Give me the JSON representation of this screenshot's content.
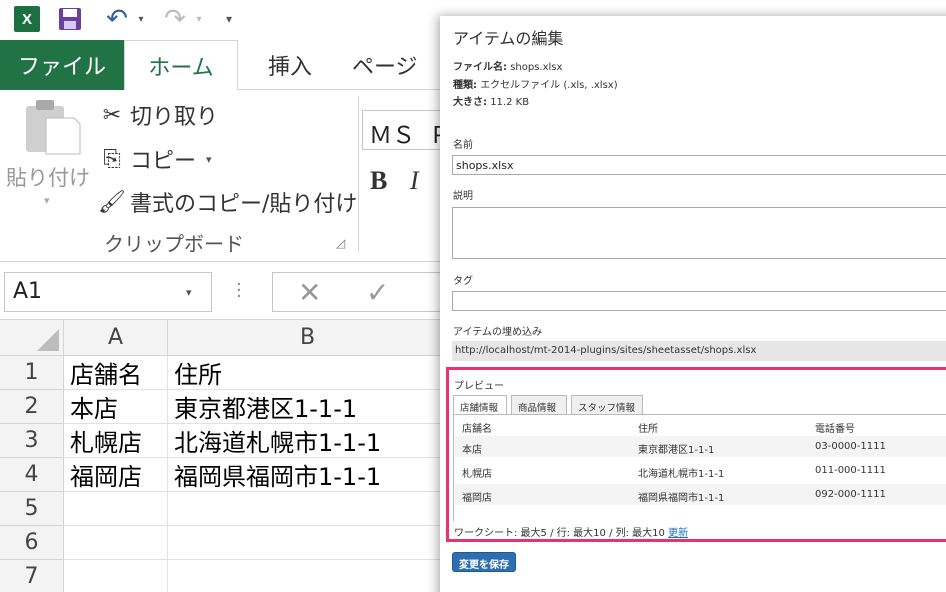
{
  "excel": {
    "logo_letter": "X",
    "tabs": [
      "ファイル",
      "ホーム",
      "挿入",
      "ページ"
    ],
    "clipboard": {
      "paste": "貼り付け",
      "cut": "切り取り",
      "copy": "コピー",
      "format_painter": "書式のコピー/貼り付け",
      "group_label": "クリップボード"
    },
    "font_name": "ＭＳ Ｐ",
    "bold": "B",
    "italic": "I",
    "name_box": "A1",
    "columns": [
      "A",
      "B"
    ],
    "rows": [
      {
        "num": "1",
        "a": "店舗名",
        "b": "住所"
      },
      {
        "num": "2",
        "a": "本店",
        "b": "東京都港区1-1-1"
      },
      {
        "num": "3",
        "a": "札幌店",
        "b": "北海道札幌市1-1-1"
      },
      {
        "num": "4",
        "a": "福岡店",
        "b": "福岡県福岡市1-1-1"
      },
      {
        "num": "5",
        "a": "",
        "b": ""
      },
      {
        "num": "6",
        "a": "",
        "b": ""
      },
      {
        "num": "7",
        "a": "",
        "b": ""
      }
    ],
    "colors": {
      "brand": "#217346",
      "qat_undo": "#2f5f9e"
    }
  },
  "dialog": {
    "title": "アイテムの編集",
    "meta": {
      "filename_label": "ファイル名:",
      "filename": "shops.xlsx",
      "type_label": "種類:",
      "type": "エクセルファイル (.xls, .xlsx)",
      "size_label": "大きさ:",
      "size": "11.2 KB"
    },
    "fields": {
      "name_label": "名前",
      "name_value": "shops.xlsx",
      "desc_label": "説明",
      "desc_value": "",
      "tags_label": "タグ",
      "tags_value": "",
      "embed_label": "アイテムの埋め込み",
      "embed_value": "http://localhost/mt-2014-plugins/sites/sheetasset/shops.xlsx"
    },
    "preview": {
      "title": "プレビュー",
      "tabs": [
        "店舗情報",
        "商品情報",
        "スタッフ情報"
      ],
      "active_tab": 0,
      "headers": [
        "店舗名",
        "住所",
        "電話番号"
      ],
      "rows": [
        [
          "本店",
          "東京都港区1-1-1",
          "03-0000-1111"
        ],
        [
          "札幌店",
          "北海道札幌市1-1-1",
          "011-000-1111"
        ],
        [
          "福岡店",
          "福岡県福岡市1-1-1",
          "092-000-1111"
        ]
      ],
      "footer": "ワークシート: 最大5 / 行: 最大10 / 列: 最大10",
      "refresh_link": "更新"
    },
    "save_button": "変更を保存",
    "colors": {
      "highlight": "#e8336d",
      "primary": "#2d6fb0",
      "link": "#1a6fc2"
    }
  }
}
